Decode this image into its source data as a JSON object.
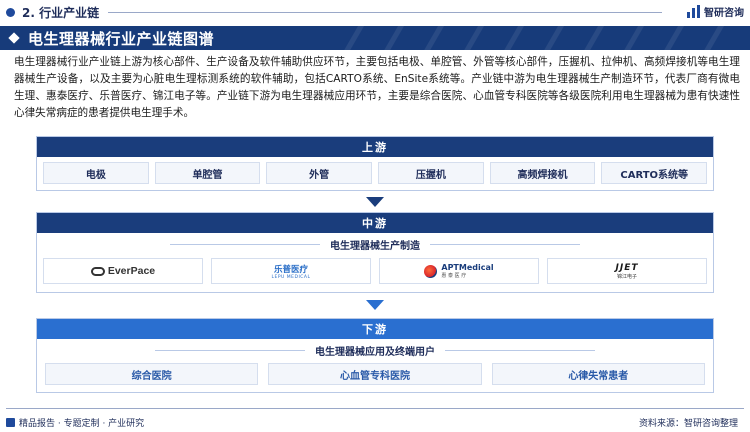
{
  "header": {
    "section": "2. 行业产业链",
    "brand": "智研咨询"
  },
  "title": "电生理器械行业产业链图谱",
  "intro": "电生理器械行业产业链上游为核心部件、生产设备及软件辅助供应环节，主要包括电极、单腔管、外管等核心部件，压握机、拉伸机、高频焊接机等电生理器械生产设备，以及主要为心脏电生理标测系统的软件辅助，包括CARTO系统、EnSite系统等。产业链中游为电生理器械生产制造环节，代表厂商有微电生理、惠泰医疗、乐普医疗、锦江电子等。产业链下游为电生理器械应用环节，主要是综合医院、心血管专科医院等各级医院利用电生理器械为患有快速性心律失常病症的患者提供电生理手术。",
  "upstream": {
    "label": "上游",
    "items": [
      "电极",
      "单腔管",
      "外管",
      "压握机",
      "高频焊接机",
      "CARTO系统等"
    ]
  },
  "midstream": {
    "label": "中游",
    "sublabel": "电生理器械生产制造",
    "logos": {
      "everpace": "EverPace",
      "lepu_cn": "乐普医疗",
      "lepu_en": "LEPU MEDICAL",
      "apt": "APTMedical",
      "apt_cn": "惠 泰 医 疗",
      "jjet": "JJET",
      "jjet_cn": "锦江电子"
    }
  },
  "downstream": {
    "label": "下游",
    "sublabel": "电生理器械应用及终端用户",
    "items": [
      "综合医院",
      "心血管专科医院",
      "心律失常患者"
    ]
  },
  "footer": {
    "left": "精品报告 · 专题定制 · 产业研究",
    "right": "资料来源：智研咨询整理"
  },
  "colors": {
    "navy": "#1a3d7c",
    "blue": "#2a6fd0",
    "title_bg": "#173b7a"
  }
}
